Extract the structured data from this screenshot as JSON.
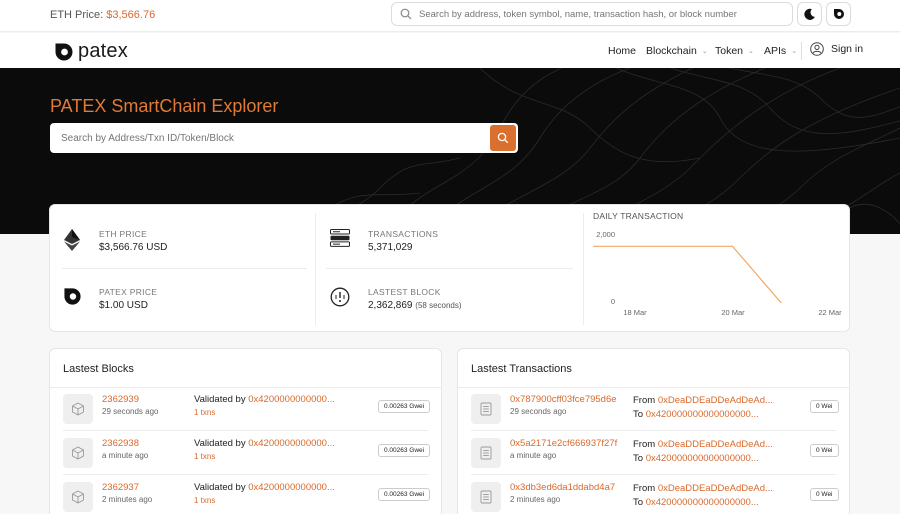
{
  "topbar": {
    "eth_price_label": "ETH Price:",
    "eth_price_value": "$3,566.76",
    "search_placeholder": "Search by address, token symbol, name, transaction hash, or block number"
  },
  "nav": {
    "logo_text": "patex",
    "items": [
      {
        "label": "Home"
      },
      {
        "label": "Blockchain"
      },
      {
        "label": "Token"
      },
      {
        "label": "APIs"
      }
    ],
    "signin_label": "Sign in"
  },
  "hero": {
    "title": "PATEX SmartChain Explorer",
    "search_placeholder": "Search by Address/Txn ID/Token/Block"
  },
  "stats": {
    "eth_price_label": "ETH PRICE",
    "eth_price_value": "$3,566.76 USD",
    "patex_price_label": "PATEX PRICE",
    "patex_price_value": "$1.00 USD",
    "transactions_label": "TRANSACTIONS",
    "transactions_value": "5,371,029",
    "latest_block_label": "LASTEST BLOCK",
    "latest_block_value": "2,362,869",
    "latest_block_time": "(58 seconds)"
  },
  "chart_data": {
    "type": "line",
    "title": "DAILY TRANSACTION",
    "y_ticks": [
      "2,000",
      "0"
    ],
    "ylim": [
      0,
      2000
    ],
    "x_ticks": [
      "18 Mar",
      "20 Mar",
      "22 Mar"
    ],
    "series": [
      {
        "x": [
          "17 Mar",
          "18 Mar",
          "19 Mar",
          "20 Mar",
          "21 Mar"
        ],
        "values": [
          1620,
          1620,
          1620,
          1620,
          0
        ]
      }
    ],
    "line_color": "#f0a865",
    "grid": false
  },
  "blocks": {
    "title": "Lastest Blocks",
    "rows": [
      {
        "number": "2362939",
        "ago": "29 seconds ago",
        "validated_label": "Validated by",
        "validator": "0x4200000000000...",
        "txns": "1 txns",
        "fee": "0.00263 Gwei"
      },
      {
        "number": "2362938",
        "ago": "a minute ago",
        "validated_label": "Validated by",
        "validator": "0x4200000000000...",
        "txns": "1 txns",
        "fee": "0.00263 Gwei"
      },
      {
        "number": "2362937",
        "ago": "2 minutes ago",
        "validated_label": "Validated by",
        "validator": "0x4200000000000...",
        "txns": "1 txns",
        "fee": "0.00263 Gwei"
      }
    ]
  },
  "transactions": {
    "title": "Lastest Transactions",
    "rows": [
      {
        "hash": "0x787900cff03fce795d6e",
        "ago": "29 seconds ago",
        "from_label": "From",
        "from": "0xDeaDDEaDDeAdDeAd...",
        "to_label": "To",
        "to": "0x420000000000000000...",
        "value": "0 Wei"
      },
      {
        "hash": "0x5a2171e2cf666937f27f",
        "ago": "a minute ago",
        "from_label": "From",
        "from": "0xDeaDDEaDDeAdDeAd...",
        "to_label": "To",
        "to": "0x420000000000000000...",
        "value": "0 Wei"
      },
      {
        "hash": "0x3db3ed6da1ddabd4a7",
        "ago": "2 minutes ago",
        "from_label": "From",
        "from": "0xDeaDDEaDDeAdDeAd...",
        "to_label": "To",
        "to": "0x420000000000000000...",
        "value": "0 Wei"
      }
    ]
  },
  "colors": {
    "accent": "#d9692c",
    "hero_bg": "#0b0b0b"
  }
}
